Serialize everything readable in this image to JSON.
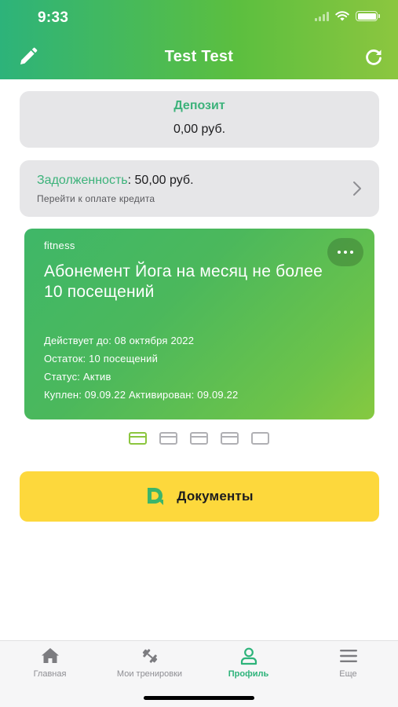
{
  "status_bar": {
    "time": "9:33"
  },
  "header": {
    "title": "Test Test"
  },
  "deposit": {
    "title": "Депозит",
    "value": "0,00 руб."
  },
  "debt": {
    "label": "Задолженность",
    "value": ": 50,00 руб.",
    "subtitle": "Перейти к оплате кредита"
  },
  "subscription": {
    "category": "fitness",
    "title": "Абонемент Йога на месяц не более 10 посещений",
    "valid_until": "Действует до: 08 октября 2022",
    "remaining": "Остаток: 10 посещений",
    "status": "Статус: Актив",
    "purchased": "Куплен: 09.09.22 Активирован: 09.09.22"
  },
  "pager": {
    "count": 5,
    "active_index": 0
  },
  "documents_button": {
    "label": "Документы"
  },
  "tabbar": {
    "items": [
      {
        "label": "Главная",
        "icon": "home-icon",
        "active": false
      },
      {
        "label": "Мои тренировки",
        "icon": "dumbbell-icon",
        "active": false
      },
      {
        "label": "Профиль",
        "icon": "profile-icon",
        "active": true
      },
      {
        "label": "Еще",
        "icon": "menu-icon",
        "active": false
      }
    ]
  },
  "colors": {
    "accent_green": "#2db37a",
    "lime": "#8cc63f",
    "docs_yellow": "#fdd83c",
    "card_gray": "#e6e6e8"
  }
}
